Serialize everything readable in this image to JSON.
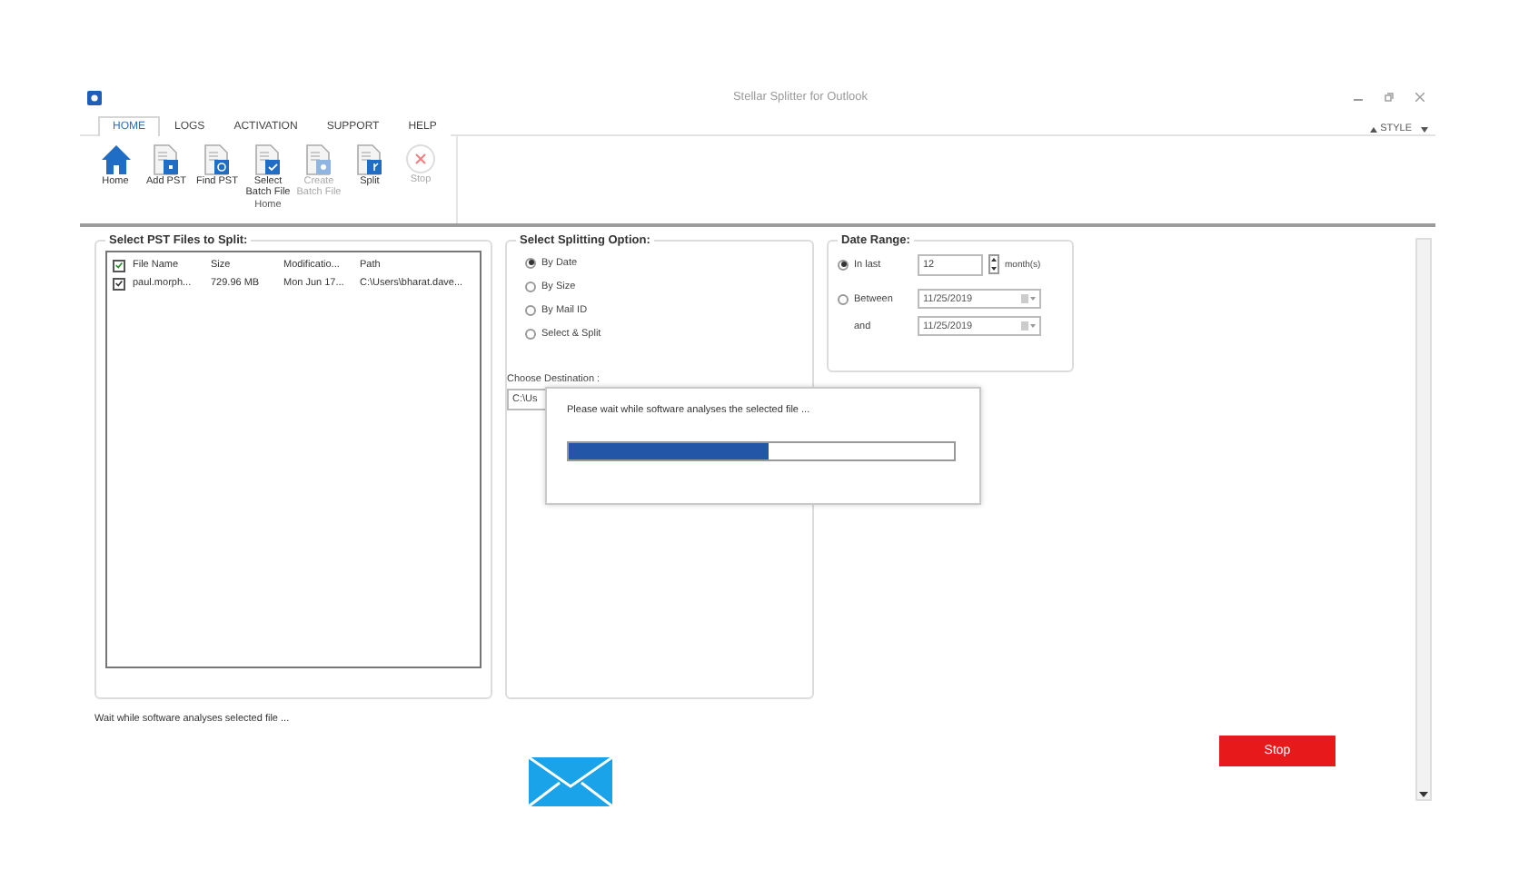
{
  "window": {
    "title": "Stellar Splitter for Outlook"
  },
  "tabs": [
    {
      "label": "HOME",
      "selected": true
    },
    {
      "label": "LOGS",
      "selected": false
    },
    {
      "label": "ACTIVATION",
      "selected": false
    },
    {
      "label": "SUPPORT",
      "selected": false
    },
    {
      "label": "HELP",
      "selected": false
    }
  ],
  "style_menu": {
    "label": "STYLE"
  },
  "ribbon": {
    "group_label": "Home",
    "buttons": [
      {
        "kind": "home",
        "label": "Home",
        "disabled": false
      },
      {
        "kind": "add",
        "label": "Add PST",
        "disabled": false
      },
      {
        "kind": "find",
        "label": "Find PST",
        "disabled": false
      },
      {
        "kind": "select",
        "label": "Select Batch File",
        "disabled": false
      },
      {
        "kind": "create",
        "label": "Create Batch File",
        "disabled": true
      },
      {
        "kind": "split",
        "label": "Split",
        "disabled": false
      },
      {
        "kind": "stop",
        "label": "Stop",
        "disabled": true
      }
    ]
  },
  "file_panel": {
    "title": "Select PST Files to Split:",
    "all_checked": true,
    "columns": [
      "File Name",
      "Size",
      "Modificatio...",
      "Path"
    ],
    "rows": [
      {
        "checked": true,
        "cells": [
          "paul.morph...",
          "729.96 MB",
          "Mon Jun 17...",
          "C:\\Users\\bharat.dave..."
        ]
      }
    ]
  },
  "split_panel": {
    "title": "Select Splitting Option:",
    "options": [
      {
        "label": "By Date",
        "selected": true
      },
      {
        "label": "By Size",
        "selected": false
      },
      {
        "label": "By Mail ID",
        "selected": false
      },
      {
        "label": "Select & Split",
        "selected": false
      }
    ],
    "destination_label": "Choose Destination :",
    "destination_value": "C:\\Us"
  },
  "date_range": {
    "title": "Date Range:",
    "in_last": {
      "label": "In last",
      "selected": true,
      "value": "12",
      "unit": "month(s)"
    },
    "between": {
      "label": "Between",
      "selected": false,
      "from": "11/25/2019",
      "and_label": "and",
      "to": "11/25/2019"
    }
  },
  "progress_dialog": {
    "message": "Please wait while software analyses the selected file ...",
    "level": 0.52
  },
  "status_text": "Wait while software analyses selected file ...",
  "stop_button": {
    "label": "Stop"
  }
}
